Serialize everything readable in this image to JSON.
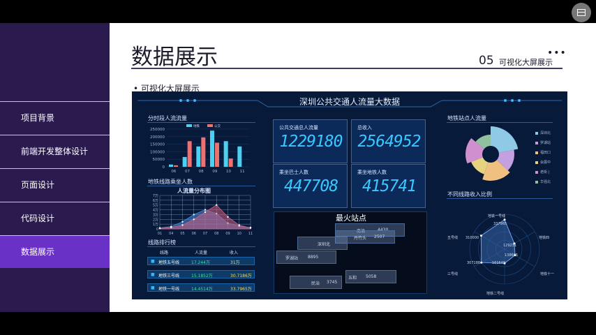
{
  "sidebar": {
    "items": [
      {
        "label": "项目背景"
      },
      {
        "label": "前端开发整体设计"
      },
      {
        "label": "页面设计"
      },
      {
        "label": "代码设计"
      },
      {
        "label": "数据展示",
        "active": true
      }
    ]
  },
  "header": {
    "title": "数据展示",
    "menu_dots": "•••",
    "section_number": "05",
    "section_label": "可视化大屏展示"
  },
  "bullet_text": "• 可视化大屏展示",
  "dashboard": {
    "title": "深圳公共交通人流量大数据",
    "hourly": {
      "title": "分时段人流流量",
      "legend": [
        "地铁",
        "公交"
      ],
      "y_ticks": [
        "250000",
        "200000",
        "150000",
        "100000",
        "50000",
        "0"
      ],
      "x_ticks": [
        "06",
        "07",
        "08",
        "09",
        "10",
        "11"
      ]
    },
    "line_ride": {
      "title": "地铁线路乘坐人数",
      "chart_title": "人流量分布图",
      "y_ticks": [
        "7万",
        "6万",
        "5万",
        "4万",
        "3万",
        "2万",
        "1万",
        "0"
      ],
      "x_ticks": [
        "01",
        "04",
        "05",
        "06",
        "07",
        "08",
        "09",
        "10",
        "11"
      ]
    },
    "ranking": {
      "title": "线路排行榜",
      "headers": [
        "线路",
        "人流量",
        "收入"
      ],
      "rows": [
        {
          "line": "地铁五号线",
          "flow": "17.244万",
          "income": "31万"
        },
        {
          "line": "地铁三号线",
          "flow": "15.1852万",
          "income": "30.7186万"
        },
        {
          "line": "地铁一号线",
          "flow": "14.4514万",
          "income": "33.7965万"
        }
      ]
    },
    "kpis": [
      {
        "label": "公共交通总人流量",
        "value": "1229180"
      },
      {
        "label": "总收入",
        "value": "2564952"
      },
      {
        "label": "乘坐巴士人数",
        "value": "447708"
      },
      {
        "label": "乘坐地铁人数",
        "value": "415741"
      }
    ],
    "hot_stations": {
      "title": "最火站点",
      "stations": [
        {
          "name": "南油",
          "value": "4430"
        },
        {
          "name": "丹竹头",
          "value": "2507"
        },
        {
          "name": "深圳北",
          "value": ""
        },
        {
          "name": "罗湖站",
          "value": "8895"
        },
        {
          "name": "民治",
          "value": "3745"
        },
        {
          "name": "五和",
          "value": "5058"
        }
      ]
    },
    "station_flow": {
      "title": "地铁站点人流量",
      "legend": [
        "深圳北",
        "罗湖站",
        "福田口",
        "会展中",
        "老街 |",
        "华强北"
      ]
    },
    "line_income": {
      "title": "不同线路收入比例",
      "labels": [
        "地铁一号线",
        "地铁四",
        "地铁十一",
        "地铁二号线",
        "三号线",
        "五号线"
      ],
      "values": [
        "337965",
        "310000",
        "129231",
        "138605",
        "161649",
        "307188"
      ]
    }
  },
  "chart_data": [
    {
      "type": "bar",
      "title": "分时段人流流量",
      "categories": [
        "06",
        "07",
        "08",
        "09",
        "10",
        "11"
      ],
      "ylim": [
        0,
        250000
      ],
      "legend": "top",
      "series": [
        {
          "name": "地铁",
          "values": [
            15000,
            65000,
            135000,
            240000,
            170000,
            135000
          ],
          "color": "#4dd0f0"
        },
        {
          "name": "公交",
          "values": [
            10000,
            170000,
            195000,
            160000,
            55000,
            0
          ],
          "color": "#f07070"
        }
      ]
    },
    {
      "type": "area",
      "title": "人流量分布图",
      "categories": [
        "01",
        "04",
        "05",
        "06",
        "07",
        "08",
        "09",
        "10",
        "11"
      ],
      "ylim": [
        0,
        7
      ],
      "series": [
        {
          "values": [
            0.2,
            0.5,
            1.5,
            3.0,
            4.0,
            3.2,
            1.2,
            0.6,
            0.3
          ],
          "color": "#4a8ad8"
        },
        {
          "values": [
            0.1,
            0.3,
            0.8,
            2.0,
            3.5,
            5.0,
            2.5,
            0.8,
            0.2
          ],
          "color": "#d06080"
        }
      ]
    },
    {
      "type": "pie",
      "title": "地铁站点人流量",
      "categories": [
        "深圳北",
        "罗湖站",
        "福田口",
        "会展中",
        "老街 |",
        "华强北"
      ],
      "values": [
        22,
        15,
        18,
        14,
        17,
        14
      ],
      "colors": [
        "#8ecae6",
        "#c4a0e0",
        "#f0c080",
        "#e6d380",
        "#d090d0",
        "#90c0a0"
      ]
    },
    {
      "type": "radar",
      "title": "不同线路收入比例",
      "categories": [
        "地铁一号线",
        "地铁四",
        "地铁十一",
        "地铁二号线",
        "三号线",
        "五号线"
      ],
      "values": [
        337965,
        129231,
        138605,
        161649,
        307188,
        310000
      ],
      "max": 400000
    }
  ]
}
